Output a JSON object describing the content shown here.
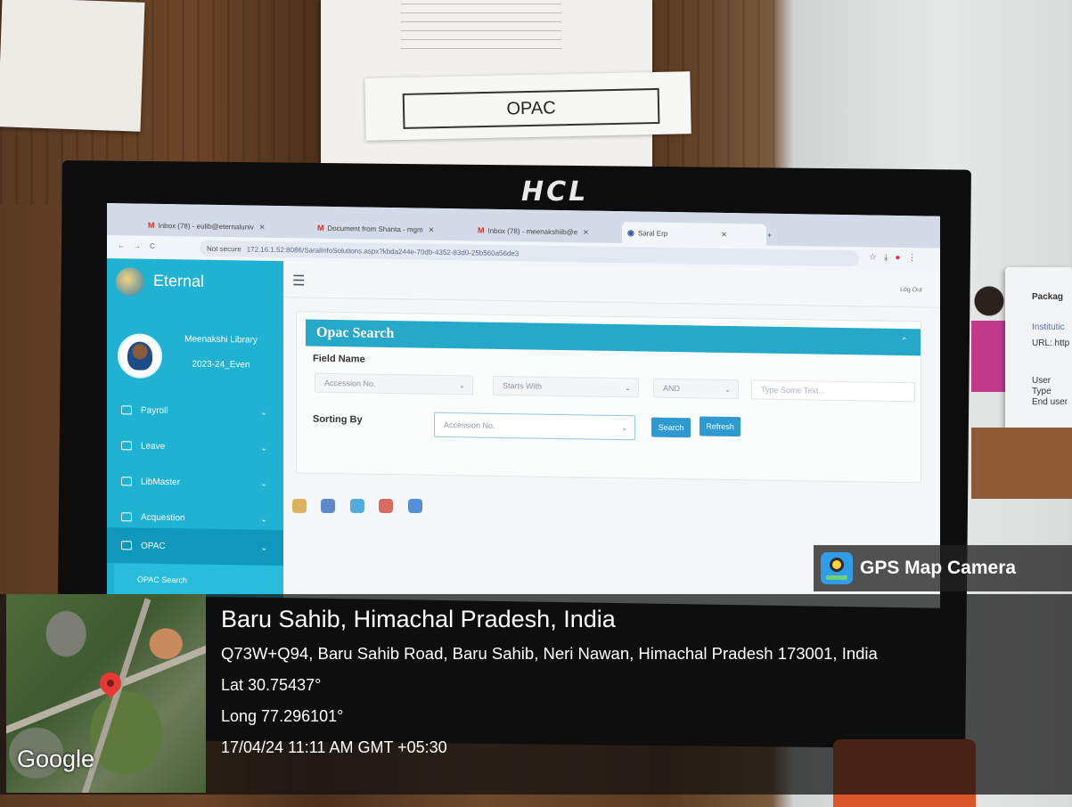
{
  "sign": {
    "label": "OPAC"
  },
  "monitor": {
    "brand": "HCL"
  },
  "browser": {
    "tabs": [
      {
        "icon": "gmail-icon",
        "label": "Inbox (78) - eulib@eternaluniv"
      },
      {
        "icon": "gmail-icon",
        "label": "Document from Shanta - mgm"
      },
      {
        "icon": "gmail-icon",
        "label": "Inbox (78) - meenakshiib@e"
      },
      {
        "icon": "globe-icon",
        "label": "Saral Erp"
      }
    ],
    "security_label": "Not secure",
    "url": "172.16.1.52:8086/SaralInfoSolutions.aspx?kbda244e-70db-4352-83d0-25b560a56de3"
  },
  "app": {
    "name": "Eternal",
    "user": {
      "name": "Meenakshi Library",
      "session": "2023-24_Even"
    },
    "menu": [
      "Payroll",
      "Leave",
      "LibMaster",
      "Acquestion",
      "OPAC"
    ],
    "submenu": {
      "opac_search": "OPAC Search"
    },
    "logout": "Log Out"
  },
  "opac": {
    "title": "Opac Search",
    "field_name_label": "Field Name",
    "field_select": "Accession No.",
    "condition_select": "Starts With",
    "operator_select": "AND",
    "search_placeholder": "Type Some Text...",
    "sorting_label": "Sorting By",
    "sorting_select": "Accession No.",
    "search_button": "Search",
    "refresh_button": "Refresh"
  },
  "gps": {
    "app_name": "GPS Map Camera",
    "place": "Baru Sahib, Himachal Pradesh, India",
    "address": "Q73W+Q94, Baru Sahib Road, Baru Sahib, Neri Nawan, Himachal Pradesh 173001, India",
    "lat": "Lat 30.75437°",
    "long": "Long 77.296101°",
    "timestamp": "17/04/24 11:11 AM GMT +05:30",
    "map_attribution": "Google"
  },
  "colors": {
    "sidebar": "#1fb2d3",
    "panel_header": "#26a9c9",
    "button": "#2f9ad2"
  }
}
